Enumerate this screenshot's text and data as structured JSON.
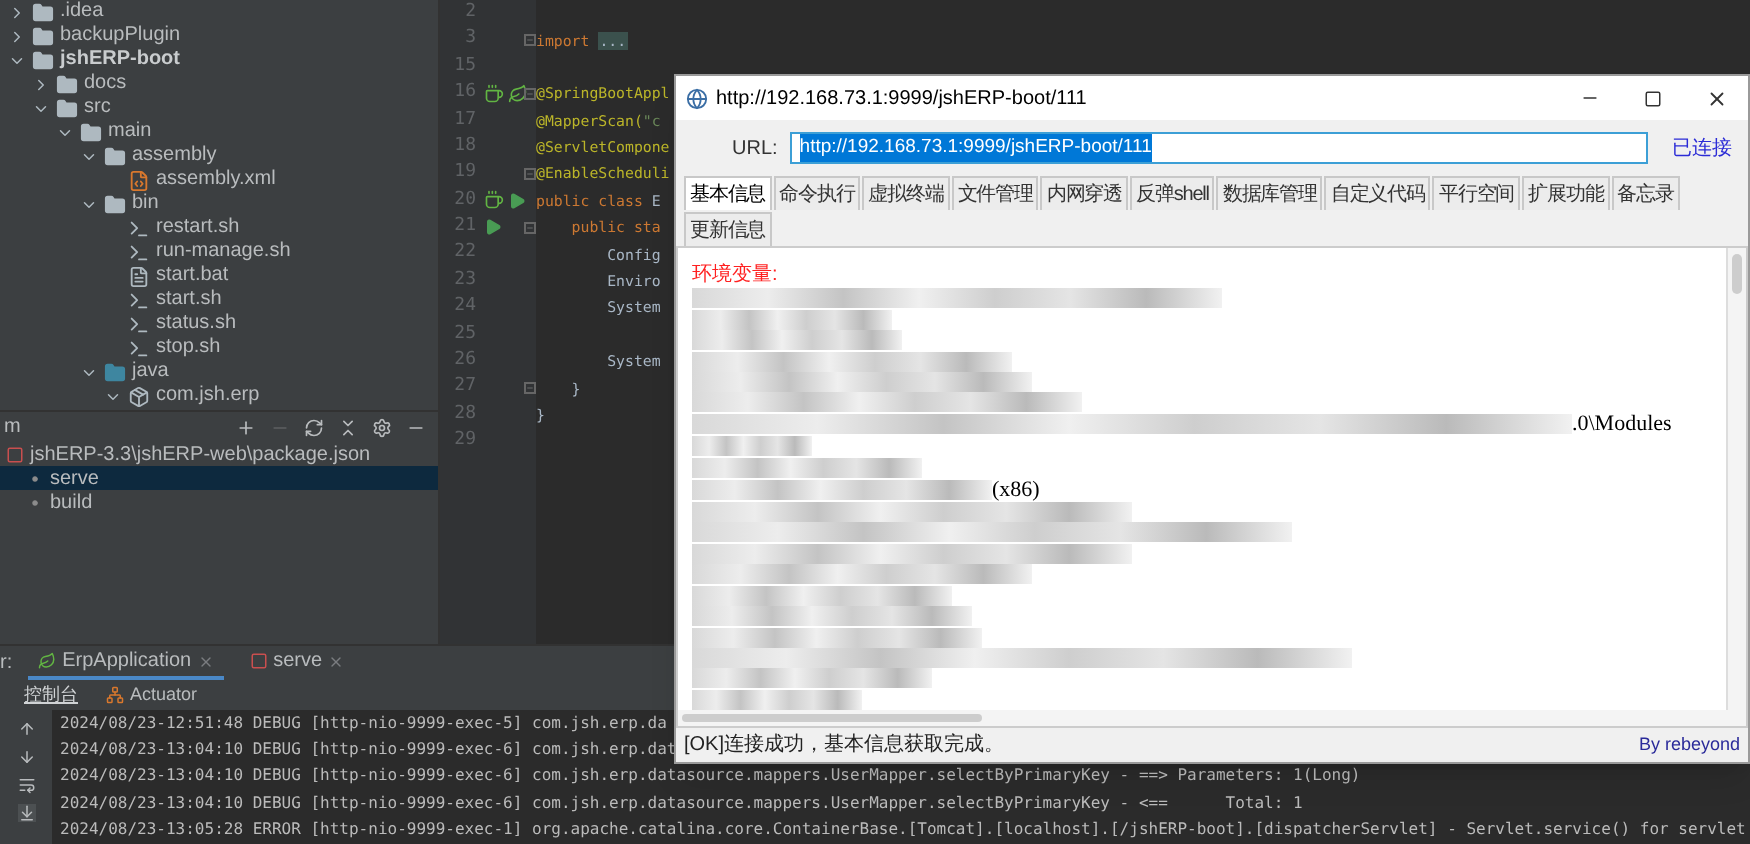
{
  "project_tree": [
    {
      "label": ".idea",
      "kind": "folder",
      "expanded": false
    },
    {
      "label": "backupPlugin",
      "kind": "folder",
      "expanded": false
    },
    {
      "label": "jshERP-boot",
      "kind": "module",
      "expanded": true,
      "children": [
        {
          "label": "docs",
          "kind": "folder",
          "expanded": false
        },
        {
          "label": "src",
          "kind": "folder",
          "expanded": true,
          "children": [
            {
              "label": "main",
              "kind": "folder",
              "expanded": true,
              "children": [
                {
                  "label": "assembly",
                  "kind": "folder",
                  "expanded": true,
                  "children": [
                    {
                      "label": "assembly.xml",
                      "kind": "xml"
                    }
                  ]
                },
                {
                  "label": "bin",
                  "kind": "folder",
                  "expanded": true,
                  "children": [
                    {
                      "label": "restart.sh",
                      "kind": "script"
                    },
                    {
                      "label": "run-manage.sh",
                      "kind": "script"
                    },
                    {
                      "label": "start.bat",
                      "kind": "bat"
                    },
                    {
                      "label": "start.sh",
                      "kind": "script"
                    },
                    {
                      "label": "status.sh",
                      "kind": "script"
                    },
                    {
                      "label": "stop.sh",
                      "kind": "script"
                    }
                  ]
                },
                {
                  "label": "java",
                  "kind": "source",
                  "expanded": true,
                  "children": [
                    {
                      "label": "com.jsh.erp",
                      "kind": "package",
                      "expanded": true
                    }
                  ]
                }
              ]
            }
          ]
        }
      ]
    }
  ],
  "npm_panel": {
    "title": "m",
    "root": "jshERP-3.3\\jshERP-web\\package.json",
    "scripts": [
      {
        "label": "serve",
        "selected": true
      },
      {
        "label": "build",
        "selected": false
      }
    ]
  },
  "editor": {
    "lines": [
      {
        "number": "2"
      },
      {
        "number": "3",
        "fold": true,
        "code": [
          {
            "text": "import",
            "kind": "keyword"
          },
          {
            "text": "...",
            "kind": "folded"
          }
        ]
      },
      {
        "number": "15"
      },
      {
        "number": "16",
        "fold": true,
        "bean_marker": true,
        "spring_marker": true,
        "code": [
          {
            "text": "@SpringBootAppl",
            "kind": "annotation"
          }
        ]
      },
      {
        "number": "17",
        "code": [
          {
            "text": "@MapperScan(",
            "kind": "annotation"
          },
          {
            "text": "\"c",
            "kind": "string"
          }
        ]
      },
      {
        "number": "18",
        "code": [
          {
            "text": "@ServletCompone",
            "kind": "annotation"
          }
        ]
      },
      {
        "number": "19",
        "fold": true,
        "code": [
          {
            "text": "@EnableScheduli",
            "kind": "annotation"
          }
        ]
      },
      {
        "number": "20",
        "bean_marker": true,
        "run_marker": true,
        "code": [
          {
            "text": "public class",
            "kind": "keyword"
          },
          {
            "text": " E",
            "kind": "plain"
          }
        ]
      },
      {
        "number": "21",
        "fold": true,
        "run_marker": true,
        "code": [
          {
            "text": "    public sta",
            "kind": "keyword"
          }
        ]
      },
      {
        "number": "22",
        "code": [
          {
            "text": "        Config",
            "kind": "plain"
          }
        ]
      },
      {
        "number": "23",
        "code": [
          {
            "text": "        Enviro",
            "kind": "plain"
          }
        ]
      },
      {
        "number": "24",
        "code": [
          {
            "text": "        System",
            "kind": "plain"
          }
        ]
      },
      {
        "number": "25"
      },
      {
        "number": "26",
        "code": [
          {
            "text": "        System",
            "kind": "plain"
          }
        ]
      },
      {
        "number": "27",
        "fold": true,
        "code": [
          {
            "text": "    }",
            "kind": "plain"
          }
        ]
      },
      {
        "number": "28",
        "code": [
          {
            "text": "}",
            "kind": "plain"
          }
        ]
      },
      {
        "number": "29"
      }
    ]
  },
  "popup": {
    "title": "http://192.168.73.1:9999/jshERP-boot/111",
    "url_label": "URL:",
    "url": "http://192.168.73.1:9999/jshERP-boot/111",
    "url_selected": true,
    "status_link": "已连接",
    "tabs": [
      {
        "label": "基本信息",
        "selected": true
      },
      {
        "label": "命令执行",
        "selected": false
      },
      {
        "label": "虚拟终端",
        "selected": false
      },
      {
        "label": "文件管理",
        "selected": false
      },
      {
        "label": "内网穿透",
        "selected": false
      },
      {
        "label": "反弹shell",
        "selected": false
      },
      {
        "label": "数据库管理",
        "selected": false
      },
      {
        "label": "自定义代码",
        "selected": false
      },
      {
        "label": "平行空间",
        "selected": false
      },
      {
        "label": "扩展功能",
        "selected": false
      },
      {
        "label": "备忘录",
        "selected": false
      },
      {
        "label": "更新信息",
        "selected": false
      }
    ],
    "content": {
      "heading": "环境变量:",
      "rows": [
        {
          "kind": "redacted"
        },
        {
          "kind": "redacted"
        },
        {
          "kind": "redacted"
        },
        {
          "kind": "redacted"
        },
        {
          "kind": "redacted"
        },
        {
          "kind": "redacted"
        },
        {
          "kind": "tail",
          "text": ".0\\Modules"
        },
        {
          "kind": "redacted"
        },
        {
          "kind": "redacted"
        },
        {
          "kind": "tail",
          "text": "(x86)"
        },
        {
          "kind": "redacted"
        },
        {
          "kind": "redacted"
        },
        {
          "kind": "redacted"
        },
        {
          "kind": "redacted"
        },
        {
          "kind": "redacted"
        },
        {
          "kind": "redacted"
        },
        {
          "kind": "redacted"
        },
        {
          "kind": "redacted"
        },
        {
          "kind": "redacted"
        },
        {
          "kind": "redacted"
        }
      ]
    },
    "status": "[OK]连接成功，基本信息获取完成。",
    "credit": "By rebeyond"
  },
  "run_panel": {
    "label": "r:",
    "tabs": [
      {
        "label": "ErpApplication",
        "kind": "spring",
        "selected": true
      },
      {
        "label": "serve",
        "kind": "npm",
        "selected": false
      }
    ],
    "subtabs": [
      {
        "label": "控制台",
        "selected": true
      },
      {
        "label": "Actuator",
        "selected": false
      }
    ],
    "log_lines": [
      {
        "text": "2024/08/23-12:51:48 DEBUG [http-nio-9999-exec-5] com.jsh.erp.da"
      },
      {
        "text": "2024/08/23-13:04:10 DEBUG [http-nio-9999-exec-6] com.jsh.erp.dat"
      },
      {
        "text": "2024/08/23-13:04:10 DEBUG [http-nio-9999-exec-6] com.jsh.erp.datasource.mappers.UserMapper.selectByPrimaryKey - ==> Parameters: 1(Long)"
      },
      {
        "text": "2024/08/23-13:04:10 DEBUG [http-nio-9999-exec-6] com.jsh.erp.datasource.mappers.UserMapper.selectByPrimaryKey - <==      Total: 1"
      },
      {
        "text": "2024/08/23-13:05:28 ERROR [http-nio-9999-exec-1] org.apache.catalina.core.ContainerBase.[Tomcat].[localhost].[/jshERP-boot].[dispatcherServlet] - Servlet.service() for servlet"
      }
    ]
  }
}
